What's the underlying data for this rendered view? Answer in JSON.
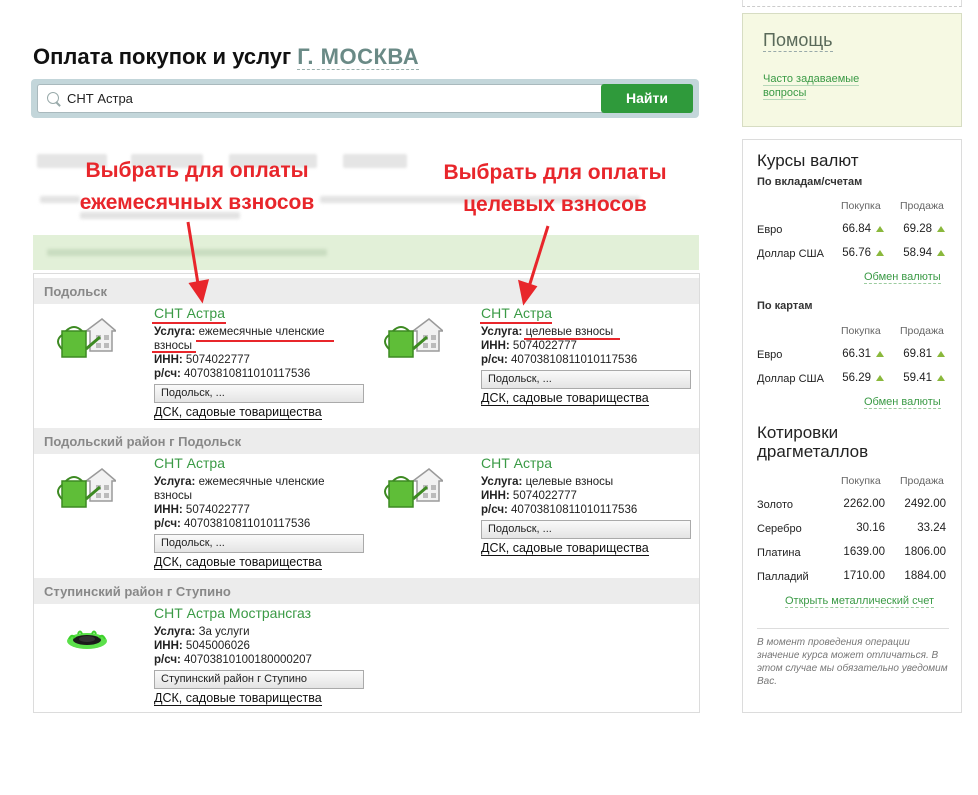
{
  "header": {
    "title": "Оплата покупок и услуг",
    "city": "Г. МОСКВА"
  },
  "search": {
    "value": "СНТ Астра",
    "button_label": "Найти"
  },
  "annotations": {
    "left": [
      "Выбрать для оплаты",
      "ежемесячных взносов"
    ],
    "right": [
      "Выбрать для оплаты",
      "целевых взносов"
    ],
    "color": "#e8262b"
  },
  "results": {
    "regions": [
      {
        "name": "Подольск",
        "cards": [
          {
            "title": "СНТ Астра",
            "service_label": "Услуга:",
            "service": "ежемесячные членские взносы",
            "inn_label": "ИНН:",
            "inn": "5074022777",
            "account_label": "р/сч:",
            "account": "40703810811010117536",
            "location": "Подольск, ...",
            "category": "ДСК, садовые товарищества",
            "icon": "watering-can-house-icon"
          },
          {
            "title": "СНТ Астра",
            "service_label": "Услуга:",
            "service": "целевые взносы",
            "inn_label": "ИНН:",
            "inn": "5074022777",
            "account_label": "р/сч:",
            "account": "40703810811010117536",
            "location": "Подольск, ...",
            "category": "ДСК, садовые товарищества",
            "icon": "watering-can-house-icon"
          }
        ]
      },
      {
        "name": "Подольский район г Подольск",
        "cards": [
          {
            "title": "СНТ Астра",
            "service_label": "Услуга:",
            "service": "ежемесячные членские взносы",
            "inn_label": "ИНН:",
            "inn": "5074022777",
            "account_label": "р/сч:",
            "account": "40703810811010117536",
            "location": "Подольск, ...",
            "category": "ДСК, садовые товарищества",
            "icon": "watering-can-house-icon"
          },
          {
            "title": "СНТ Астра",
            "service_label": "Услуга:",
            "service": "целевые взносы",
            "inn_label": "ИНН:",
            "inn": "5074022777",
            "account_label": "р/сч:",
            "account": "40703810811010117536",
            "location": "Подольск, ...",
            "category": "ДСК, садовые товарищества",
            "icon": "watering-can-house-icon"
          }
        ]
      },
      {
        "name": "Ступинский район г Ступино",
        "cards": [
          {
            "title": "СНТ Астра Мострансгаз",
            "service_label": "Услуга:",
            "service": "За услуги",
            "inn_label": "ИНН:",
            "inn": "5045006026",
            "account_label": "р/сч:",
            "account": "40703810100180000207",
            "location": "Ступинский район г Ступино",
            "category": "ДСК, садовые товарищества",
            "icon": "gas-burner-icon"
          }
        ]
      }
    ]
  },
  "sidebar": {
    "help": {
      "title": "Помощь",
      "faq_link": "Часто задаваемые вопросы"
    },
    "rates": {
      "title": "Курсы валют",
      "deposits": {
        "heading": "По вкладам/счетам",
        "col_buy": "Покупка",
        "col_sell": "Продажа",
        "rows": [
          {
            "name": "Евро",
            "buy": "66.84",
            "sell": "69.28"
          },
          {
            "name": "Доллар США",
            "buy": "56.76",
            "sell": "58.94"
          }
        ],
        "link": "Обмен валюты"
      },
      "cards": {
        "heading": "По картам",
        "col_buy": "Покупка",
        "col_sell": "Продажа",
        "rows": [
          {
            "name": "Евро",
            "buy": "66.31",
            "sell": "69.81"
          },
          {
            "name": "Доллар США",
            "buy": "56.29",
            "sell": "59.41"
          }
        ],
        "link": "Обмен валюты"
      }
    },
    "metals": {
      "title_line1": "Котировки",
      "title_line2": "драгметаллов",
      "col_buy": "Покупка",
      "col_sell": "Продажа",
      "rows": [
        {
          "name": "Золото",
          "buy": "2262.00",
          "sell": "2492.00"
        },
        {
          "name": "Серебро",
          "buy": "30.16",
          "sell": "33.24"
        },
        {
          "name": "Платина",
          "buy": "1639.00",
          "sell": "1806.00"
        },
        {
          "name": "Палладий",
          "buy": "1710.00",
          "sell": "1884.00"
        }
      ],
      "link": "Открыть металлический счет",
      "note": "В момент проведения операции значение курса может отличаться. В этом случае мы обязательно уведомим Вас."
    }
  }
}
